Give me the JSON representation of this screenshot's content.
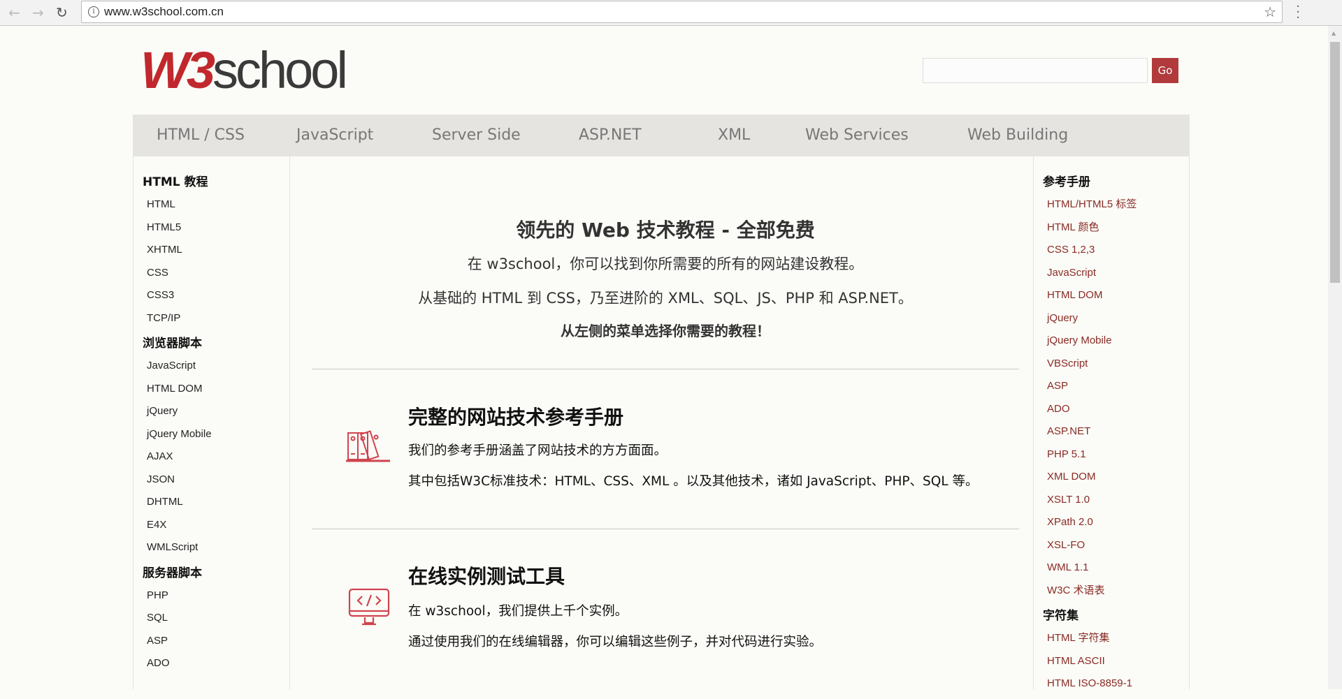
{
  "browser": {
    "url": "www.w3school.com.cn",
    "back_icon": "arrow-left-icon",
    "forward_icon": "arrow-right-icon",
    "reload_icon": "reload-icon",
    "star_icon": "star-icon",
    "menu_icon": "kebab-menu-icon"
  },
  "logo": {
    "w3": "W3",
    "school": "school"
  },
  "search": {
    "value": "",
    "placeholder": "",
    "go_label": "Go",
    "go_color": "#b03a3c"
  },
  "nav": [
    "HTML / CSS",
    "JavaScript",
    "Server Side",
    "ASP.NET",
    "XML",
    "Web Services",
    "Web Building"
  ],
  "left_sidebar": [
    {
      "heading": "HTML 教程",
      "items": [
        "HTML",
        "HTML5",
        "XHTML",
        "CSS",
        "CSS3",
        "TCP/IP"
      ]
    },
    {
      "heading": "浏览器脚本",
      "items": [
        "JavaScript",
        "HTML DOM",
        "jQuery",
        "jQuery Mobile",
        "AJAX",
        "JSON",
        "DHTML",
        "E4X",
        "WMLScript"
      ]
    },
    {
      "heading": "服务器脚本",
      "items": [
        "PHP",
        "SQL",
        "ASP",
        "ADO"
      ]
    }
  ],
  "right_sidebar": [
    {
      "heading": "参考手册",
      "items": [
        "HTML/HTML5 标签",
        "HTML 颜色",
        "CSS 1,2,3",
        "JavaScript",
        "HTML DOM",
        "jQuery",
        "jQuery Mobile",
        "VBScript",
        "ASP",
        "ADO",
        "ASP.NET",
        "PHP 5.1",
        "XML DOM",
        "XSLT 1.0",
        "XPath 2.0",
        "XSL-FO",
        "WML 1.1",
        "W3C 术语表"
      ]
    },
    {
      "heading": "字符集",
      "items": [
        "HTML 字符集",
        "HTML ASCII",
        "HTML ISO-8859-1"
      ]
    }
  ],
  "intro": {
    "title": "领先的 Web 技术教程 - 全部免费",
    "line1": "在 w3school，你可以找到你所需要的所有的网站建设教程。",
    "line2": "从基础的 HTML 到 CSS，乃至进阶的 XML、SQL、JS、PHP 和 ASP.NET。",
    "line3": "从左侧的菜单选择你需要的教程！"
  },
  "sections": [
    {
      "title": "完整的网站技术参考手册",
      "icon": "books-icon",
      "lines": [
        "我们的参考手册涵盖了网站技术的方方面面。",
        "其中包括W3C标准技术：HTML、CSS、XML 。以及其他技术，诸如 JavaScript、PHP、SQL 等。"
      ]
    },
    {
      "title": "在线实例测试工具",
      "icon": "code-monitor-icon",
      "lines": [
        "在 w3school，我们提供上千个实例。",
        "通过使用我们的在线编辑器，你可以编辑这些例子，并对代码进行实验。"
      ]
    }
  ]
}
